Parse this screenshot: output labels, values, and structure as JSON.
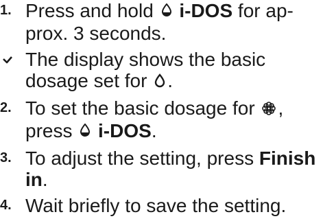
{
  "steps": [
    {
      "marker": "1.",
      "parts": [
        {
          "text": "Press and hold "
        },
        {
          "icon": "dosing-icon"
        },
        {
          "text": " i-DOS",
          "bold": true
        },
        {
          "text": " for ap-\nprox. 3 seconds."
        }
      ]
    },
    {
      "marker": "check",
      "parts": [
        {
          "text": "The display shows the basic\ndosage set for "
        },
        {
          "icon": "drop-icon"
        },
        {
          "text": "."
        }
      ]
    },
    {
      "marker": "2.",
      "parts": [
        {
          "text": "To set the basic dosage for "
        },
        {
          "icon": "flower-icon"
        },
        {
          "text": ",\npress "
        },
        {
          "icon": "dosing-icon"
        },
        {
          "text": " i-DOS",
          "bold": true
        },
        {
          "text": "."
        }
      ]
    },
    {
      "marker": "3.",
      "parts": [
        {
          "text": "To adjust the setting, press "
        },
        {
          "text": "Finish\nin",
          "bold": true
        },
        {
          "text": "."
        }
      ]
    },
    {
      "marker": "4.",
      "parts": [
        {
          "text": "Wait briefly to save the setting."
        }
      ]
    }
  ]
}
